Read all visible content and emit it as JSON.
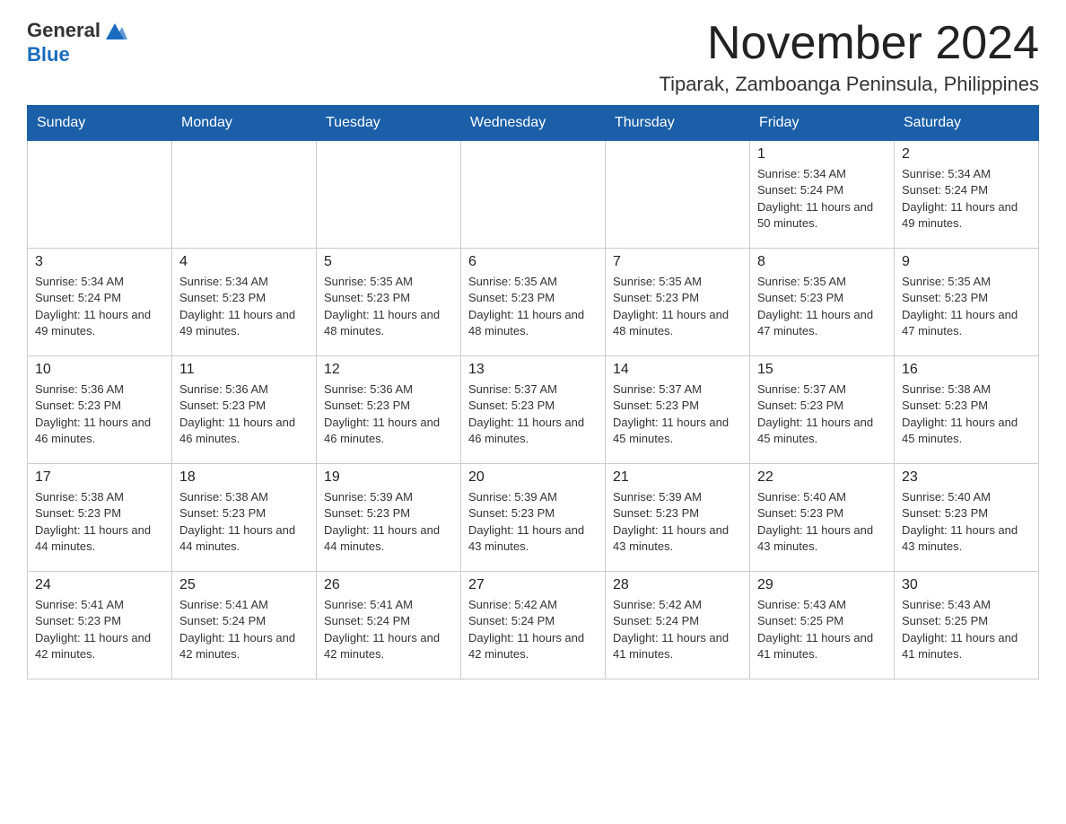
{
  "header": {
    "logo_general": "General",
    "logo_blue": "Blue",
    "month_year": "November 2024",
    "location": "Tiparak, Zamboanga Peninsula, Philippines"
  },
  "weekdays": [
    "Sunday",
    "Monday",
    "Tuesday",
    "Wednesday",
    "Thursday",
    "Friday",
    "Saturday"
  ],
  "rows": [
    [
      {
        "day": "",
        "sunrise": "",
        "sunset": "",
        "daylight": ""
      },
      {
        "day": "",
        "sunrise": "",
        "sunset": "",
        "daylight": ""
      },
      {
        "day": "",
        "sunrise": "",
        "sunset": "",
        "daylight": ""
      },
      {
        "day": "",
        "sunrise": "",
        "sunset": "",
        "daylight": ""
      },
      {
        "day": "",
        "sunrise": "",
        "sunset": "",
        "daylight": ""
      },
      {
        "day": "1",
        "sunrise": "Sunrise: 5:34 AM",
        "sunset": "Sunset: 5:24 PM",
        "daylight": "Daylight: 11 hours and 50 minutes."
      },
      {
        "day": "2",
        "sunrise": "Sunrise: 5:34 AM",
        "sunset": "Sunset: 5:24 PM",
        "daylight": "Daylight: 11 hours and 49 minutes."
      }
    ],
    [
      {
        "day": "3",
        "sunrise": "Sunrise: 5:34 AM",
        "sunset": "Sunset: 5:24 PM",
        "daylight": "Daylight: 11 hours and 49 minutes."
      },
      {
        "day": "4",
        "sunrise": "Sunrise: 5:34 AM",
        "sunset": "Sunset: 5:23 PM",
        "daylight": "Daylight: 11 hours and 49 minutes."
      },
      {
        "day": "5",
        "sunrise": "Sunrise: 5:35 AM",
        "sunset": "Sunset: 5:23 PM",
        "daylight": "Daylight: 11 hours and 48 minutes."
      },
      {
        "day": "6",
        "sunrise": "Sunrise: 5:35 AM",
        "sunset": "Sunset: 5:23 PM",
        "daylight": "Daylight: 11 hours and 48 minutes."
      },
      {
        "day": "7",
        "sunrise": "Sunrise: 5:35 AM",
        "sunset": "Sunset: 5:23 PM",
        "daylight": "Daylight: 11 hours and 48 minutes."
      },
      {
        "day": "8",
        "sunrise": "Sunrise: 5:35 AM",
        "sunset": "Sunset: 5:23 PM",
        "daylight": "Daylight: 11 hours and 47 minutes."
      },
      {
        "day": "9",
        "sunrise": "Sunrise: 5:35 AM",
        "sunset": "Sunset: 5:23 PM",
        "daylight": "Daylight: 11 hours and 47 minutes."
      }
    ],
    [
      {
        "day": "10",
        "sunrise": "Sunrise: 5:36 AM",
        "sunset": "Sunset: 5:23 PM",
        "daylight": "Daylight: 11 hours and 46 minutes."
      },
      {
        "day": "11",
        "sunrise": "Sunrise: 5:36 AM",
        "sunset": "Sunset: 5:23 PM",
        "daylight": "Daylight: 11 hours and 46 minutes."
      },
      {
        "day": "12",
        "sunrise": "Sunrise: 5:36 AM",
        "sunset": "Sunset: 5:23 PM",
        "daylight": "Daylight: 11 hours and 46 minutes."
      },
      {
        "day": "13",
        "sunrise": "Sunrise: 5:37 AM",
        "sunset": "Sunset: 5:23 PM",
        "daylight": "Daylight: 11 hours and 46 minutes."
      },
      {
        "day": "14",
        "sunrise": "Sunrise: 5:37 AM",
        "sunset": "Sunset: 5:23 PM",
        "daylight": "Daylight: 11 hours and 45 minutes."
      },
      {
        "day": "15",
        "sunrise": "Sunrise: 5:37 AM",
        "sunset": "Sunset: 5:23 PM",
        "daylight": "Daylight: 11 hours and 45 minutes."
      },
      {
        "day": "16",
        "sunrise": "Sunrise: 5:38 AM",
        "sunset": "Sunset: 5:23 PM",
        "daylight": "Daylight: 11 hours and 45 minutes."
      }
    ],
    [
      {
        "day": "17",
        "sunrise": "Sunrise: 5:38 AM",
        "sunset": "Sunset: 5:23 PM",
        "daylight": "Daylight: 11 hours and 44 minutes."
      },
      {
        "day": "18",
        "sunrise": "Sunrise: 5:38 AM",
        "sunset": "Sunset: 5:23 PM",
        "daylight": "Daylight: 11 hours and 44 minutes."
      },
      {
        "day": "19",
        "sunrise": "Sunrise: 5:39 AM",
        "sunset": "Sunset: 5:23 PM",
        "daylight": "Daylight: 11 hours and 44 minutes."
      },
      {
        "day": "20",
        "sunrise": "Sunrise: 5:39 AM",
        "sunset": "Sunset: 5:23 PM",
        "daylight": "Daylight: 11 hours and 43 minutes."
      },
      {
        "day": "21",
        "sunrise": "Sunrise: 5:39 AM",
        "sunset": "Sunset: 5:23 PM",
        "daylight": "Daylight: 11 hours and 43 minutes."
      },
      {
        "day": "22",
        "sunrise": "Sunrise: 5:40 AM",
        "sunset": "Sunset: 5:23 PM",
        "daylight": "Daylight: 11 hours and 43 minutes."
      },
      {
        "day": "23",
        "sunrise": "Sunrise: 5:40 AM",
        "sunset": "Sunset: 5:23 PM",
        "daylight": "Daylight: 11 hours and 43 minutes."
      }
    ],
    [
      {
        "day": "24",
        "sunrise": "Sunrise: 5:41 AM",
        "sunset": "Sunset: 5:23 PM",
        "daylight": "Daylight: 11 hours and 42 minutes."
      },
      {
        "day": "25",
        "sunrise": "Sunrise: 5:41 AM",
        "sunset": "Sunset: 5:24 PM",
        "daylight": "Daylight: 11 hours and 42 minutes."
      },
      {
        "day": "26",
        "sunrise": "Sunrise: 5:41 AM",
        "sunset": "Sunset: 5:24 PM",
        "daylight": "Daylight: 11 hours and 42 minutes."
      },
      {
        "day": "27",
        "sunrise": "Sunrise: 5:42 AM",
        "sunset": "Sunset: 5:24 PM",
        "daylight": "Daylight: 11 hours and 42 minutes."
      },
      {
        "day": "28",
        "sunrise": "Sunrise: 5:42 AM",
        "sunset": "Sunset: 5:24 PM",
        "daylight": "Daylight: 11 hours and 41 minutes."
      },
      {
        "day": "29",
        "sunrise": "Sunrise: 5:43 AM",
        "sunset": "Sunset: 5:25 PM",
        "daylight": "Daylight: 11 hours and 41 minutes."
      },
      {
        "day": "30",
        "sunrise": "Sunrise: 5:43 AM",
        "sunset": "Sunset: 5:25 PM",
        "daylight": "Daylight: 11 hours and 41 minutes."
      }
    ]
  ]
}
